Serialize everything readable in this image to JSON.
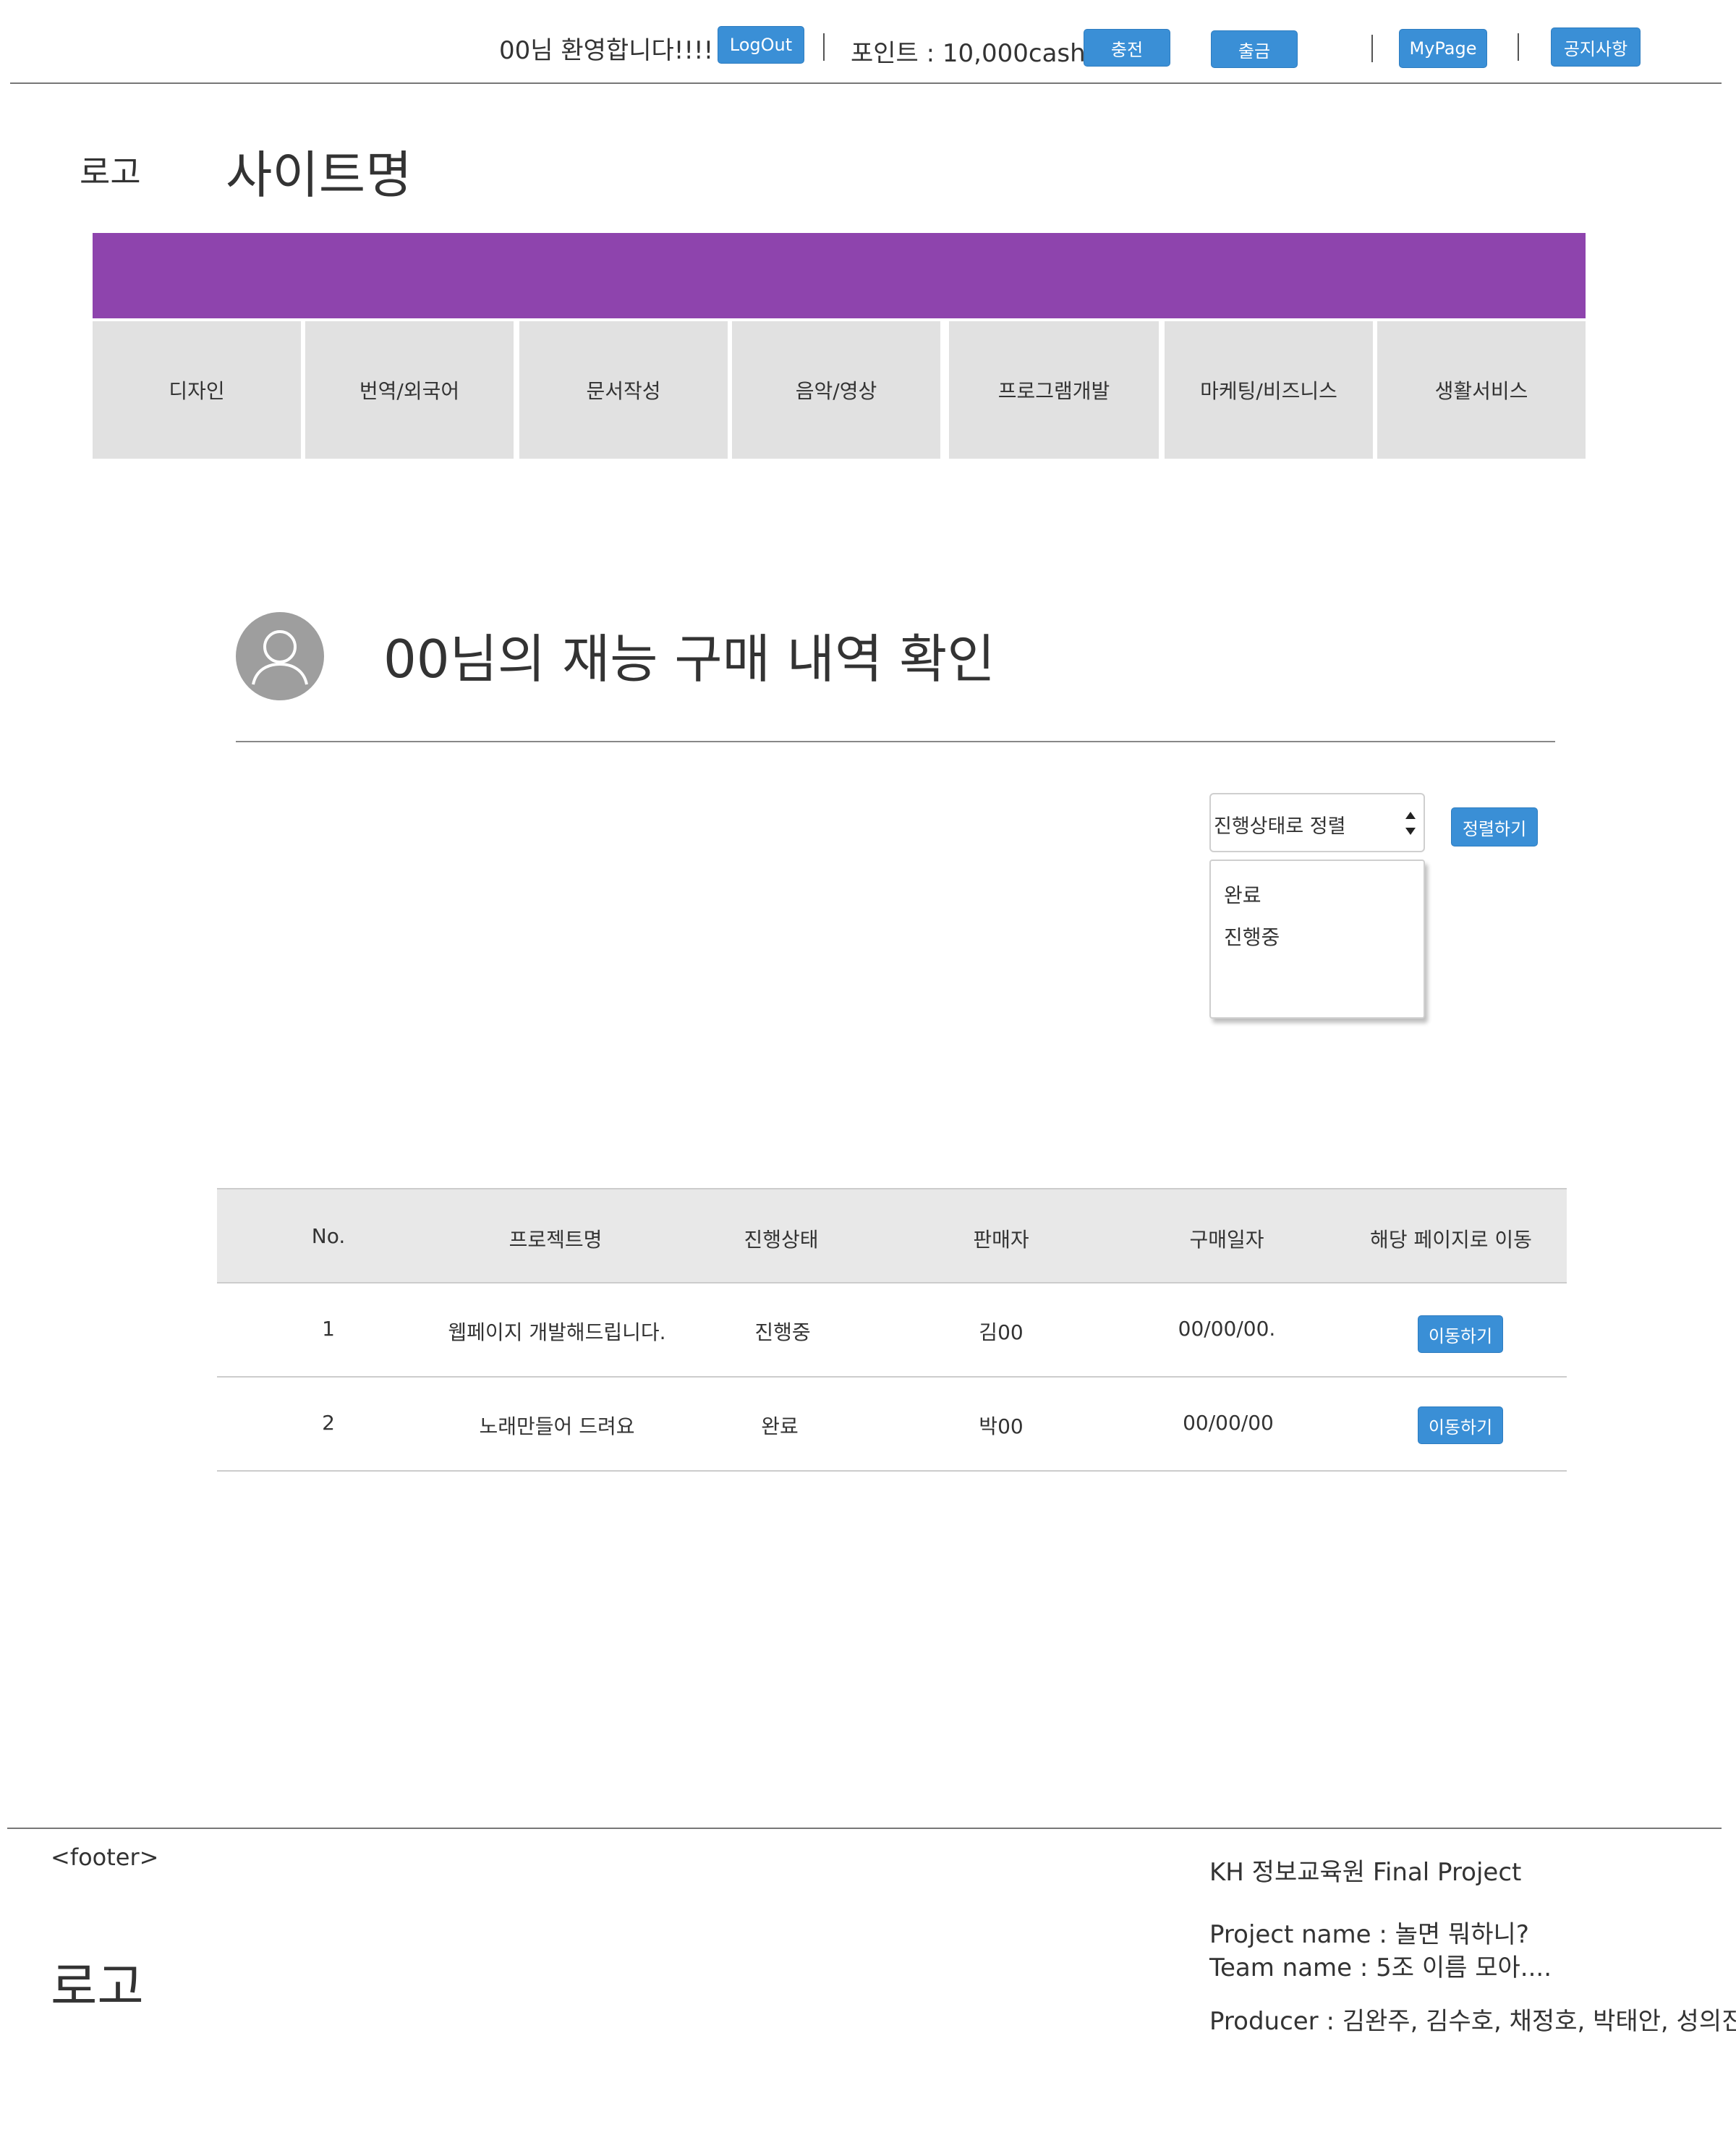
{
  "topbar": {
    "welcome": "00님 환영합니다!!!!",
    "logout_label": "LogOut",
    "points": "포인트 : 10,000cash",
    "charge_label": "충전",
    "withdraw_label": "출금",
    "mypage_label": "MyPage",
    "notice_label": "공지사항"
  },
  "header": {
    "logo": "로고",
    "site_name": "사이트명"
  },
  "categories": [
    "디자인",
    "번역/외국어",
    "문서작성",
    "음악/영상",
    "프로그램개발",
    "마케팅/비즈니스",
    "생활서비스"
  ],
  "main": {
    "title": "00님의 재능 구매 내역 확인",
    "sort_select": "진행상태로 정렬",
    "sort_button": "정렬하기",
    "sort_options": [
      "완료",
      "진행중"
    ]
  },
  "table": {
    "headers": [
      "No.",
      "프로젝트명",
      "진행상태",
      "판매자",
      "구매일자",
      "해당 페이지로 이동"
    ],
    "rows": [
      {
        "no": "1",
        "project": "웹페이지 개발해드립니다.",
        "status": "진행중",
        "seller": "김00",
        "date": "00/00/00.",
        "action": "이동하기"
      },
      {
        "no": "2",
        "project": "노래만들어 드려요",
        "status": "완료",
        "seller": "박00",
        "date": "00/00/00",
        "action": "이동하기"
      }
    ]
  },
  "footer": {
    "tag": "<footer>",
    "logo": "로고",
    "org": "KH 정보교육원 Final Project",
    "project_name": "Project name : 놀면 뭐하니?",
    "team_name": "Team name : 5조 이름 모아....",
    "producer": "Producer : 김완주, 김수호, 채정호, 박태안, 성의진"
  },
  "colors": {
    "accent_button": "#3a8fd6",
    "nav_bar": "#8e44ad",
    "menu_bg": "#e1e1e1",
    "table_header_bg": "#e8e8e8"
  }
}
